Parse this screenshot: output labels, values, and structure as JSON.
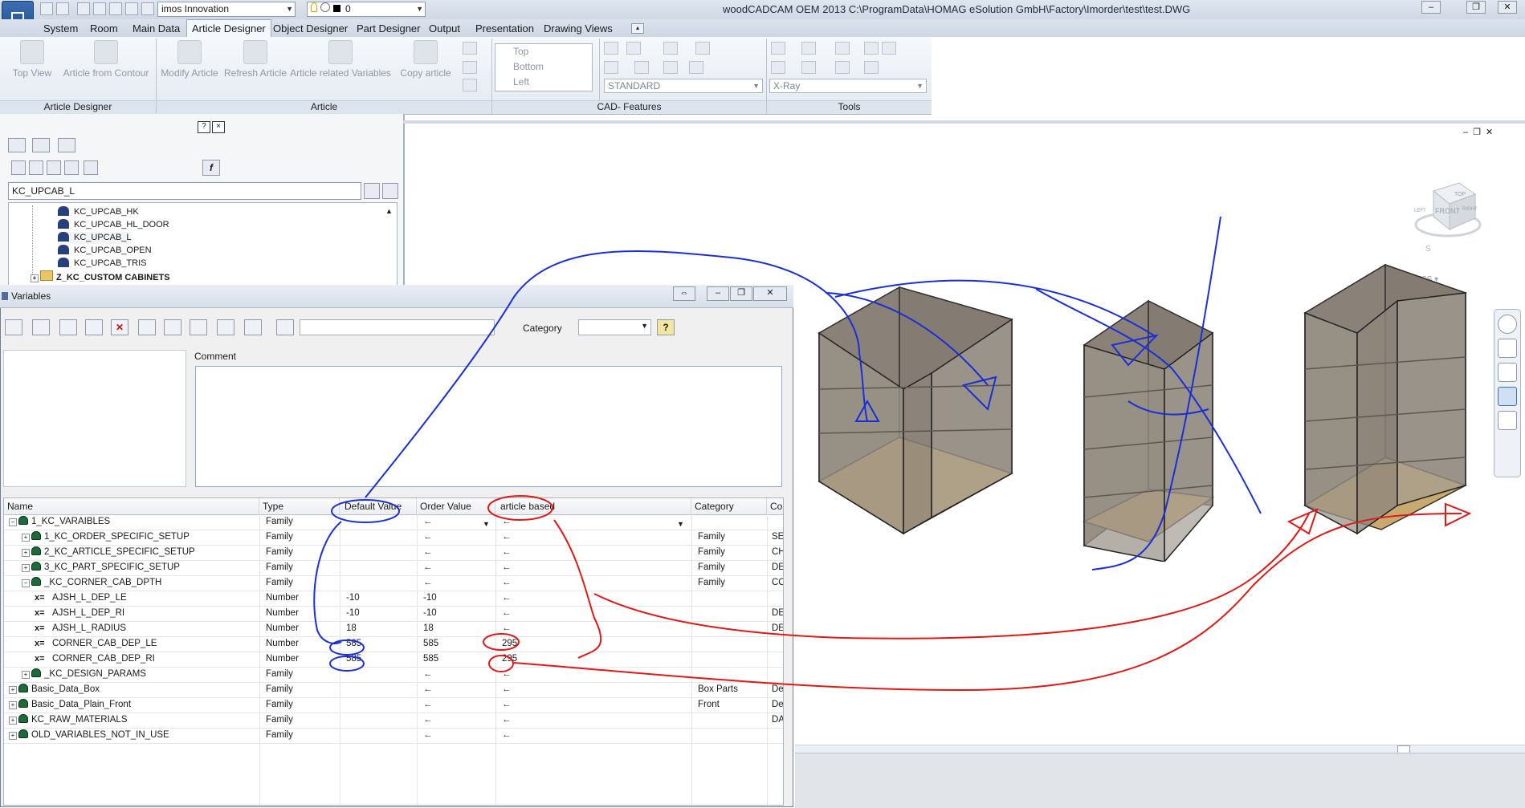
{
  "titlebar": {
    "app_title": "woodCADCAM OEM 2013     C:\\ProgramData\\HOMAG eSolution GmbH\\Factory\\Imorder\\test\\test.DWG",
    "workspace_combo": "imos Innovation",
    "layer_combo": "0"
  },
  "menu": {
    "tabs": [
      "System",
      "Room",
      "Main Data",
      "Article Designer",
      "Object Designer",
      "Part Designer",
      "Output",
      "Presentation",
      "Drawing Views"
    ],
    "active_tab": "Article Designer"
  },
  "ribbon": {
    "top_view": "Top View",
    "article_from_contour": "Article from Contour",
    "modify_article": "Modify Article",
    "refresh_article": "Refresh Article",
    "article_related_variables": "Article related Variables",
    "copy_article": "Copy article",
    "view_list": [
      "Top",
      "Bottom",
      "Left"
    ],
    "style_combo": "STANDARD",
    "visual_combo": "X-Ray",
    "groups": [
      "Article Designer",
      "Article",
      "CAD- Features",
      "Tools"
    ]
  },
  "tree_panel": {
    "filter_value": "KC_UPCAB_L",
    "items": [
      "KC_UPCAB_HK",
      "KC_UPCAB_HL_DOOR",
      "KC_UPCAB_L",
      "KC_UPCAB_OPEN",
      "KC_UPCAB_TRIS"
    ],
    "folder": "Z_KC_CUSTOM CABINETS",
    "panel_help": "?",
    "panel_close": "×",
    "function_button": "f"
  },
  "variables_window": {
    "title": "Variables",
    "category_label": "Category",
    "category_value": "",
    "comment_label": "Comment",
    "comment_value": "",
    "columns": [
      "Name",
      "Type",
      "Default Value",
      "Order Value",
      "article based",
      "Category",
      "Com"
    ],
    "rows": [
      {
        "name": "1_KC_VARAIBLES",
        "type": "Family",
        "default": "",
        "order": "←",
        "article": "←",
        "category": "",
        "comment": "",
        "level": 0,
        "kind": "family",
        "exp": "−"
      },
      {
        "name": "1_KC_ORDER_SPECIFIC_SETUP",
        "type": "Family",
        "default": "",
        "order": "←",
        "article": "←",
        "category": "Family",
        "comment": "SET",
        "level": 1,
        "kind": "family",
        "exp": "+"
      },
      {
        "name": "2_KC_ARTICLE_SPECIFIC_SETUP",
        "type": "Family",
        "default": "",
        "order": "←",
        "article": "←",
        "category": "Family",
        "comment": "CHA",
        "level": 1,
        "kind": "family",
        "exp": "+"
      },
      {
        "name": "3_KC_PART_SPECIFIC_SETUP",
        "type": "Family",
        "default": "",
        "order": "←",
        "article": "←",
        "category": "Family",
        "comment": "DEFI",
        "level": 1,
        "kind": "family",
        "exp": "+"
      },
      {
        "name": "_KC_CORNER_CAB_DPTH",
        "type": "Family",
        "default": "",
        "order": "←",
        "article": "←",
        "category": "Family",
        "comment": "CON",
        "level": 1,
        "kind": "family",
        "exp": "−"
      },
      {
        "name": "AJSH_L_DEP_LE",
        "type": "Number",
        "default": "-10",
        "order": "-10",
        "article": "←",
        "category": "",
        "comment": "",
        "level": 2,
        "kind": "var",
        "exp": ""
      },
      {
        "name": "AJSH_L_DEP_RI",
        "type": "Number",
        "default": "-10",
        "order": "-10",
        "article": "←",
        "category": "",
        "comment": "DEFI",
        "level": 2,
        "kind": "var",
        "exp": ""
      },
      {
        "name": "AJSH_L_RADIUS",
        "type": "Number",
        "default": "18",
        "order": "18",
        "article": "←",
        "category": "",
        "comment": "DEFI",
        "level": 2,
        "kind": "var",
        "exp": ""
      },
      {
        "name": "CORNER_CAB_DEP_LE",
        "type": "Number",
        "default": "585",
        "order": "585",
        "article": "295",
        "category": "",
        "comment": "",
        "level": 2,
        "kind": "var",
        "exp": ""
      },
      {
        "name": "CORNER_CAB_DEP_RI",
        "type": "Number",
        "default": "585",
        "order": "585",
        "article": "295",
        "category": "",
        "comment": "",
        "level": 2,
        "kind": "var",
        "exp": ""
      },
      {
        "name": "_KC_DESIGN_PARAMS",
        "type": "Family",
        "default": "",
        "order": "←",
        "article": "←",
        "category": "",
        "comment": "",
        "level": 1,
        "kind": "family",
        "exp": "+"
      },
      {
        "name": "Basic_Data_Box",
        "type": "Family",
        "default": "",
        "order": "←",
        "article": "←",
        "category": "Box Parts",
        "comment": "Defir",
        "level": 0,
        "kind": "family",
        "exp": "+"
      },
      {
        "name": "Basic_Data_Plain_Front",
        "type": "Family",
        "default": "",
        "order": "←",
        "article": "←",
        "category": "Front",
        "comment": "Defir",
        "level": 0,
        "kind": "family",
        "exp": "+"
      },
      {
        "name": "KC_RAW_MATERIALS",
        "type": "Family",
        "default": "",
        "order": "←",
        "article": "←",
        "category": "",
        "comment": "DAT.",
        "level": 0,
        "kind": "family",
        "exp": "+"
      },
      {
        "name": "OLD_VARIABLES_NOT_IN_USE",
        "type": "Family",
        "default": "",
        "order": "←",
        "article": "←",
        "category": "",
        "comment": "",
        "level": 0,
        "kind": "family",
        "exp": "+"
      }
    ]
  },
  "cad": {
    "viewcube_top": "TOP",
    "viewcube_front": "FRONT",
    "viewcube_left": "LEFT",
    "viewcube_right": "RIGHT",
    "viewcube_south": "S",
    "wcs_label": "WCS"
  },
  "colors": {
    "accent_blue": "#1a2fd6",
    "accent_red": "#e01818",
    "cabinet_fill": "#8a8278",
    "cabinet_floor": "#c9a96e"
  }
}
